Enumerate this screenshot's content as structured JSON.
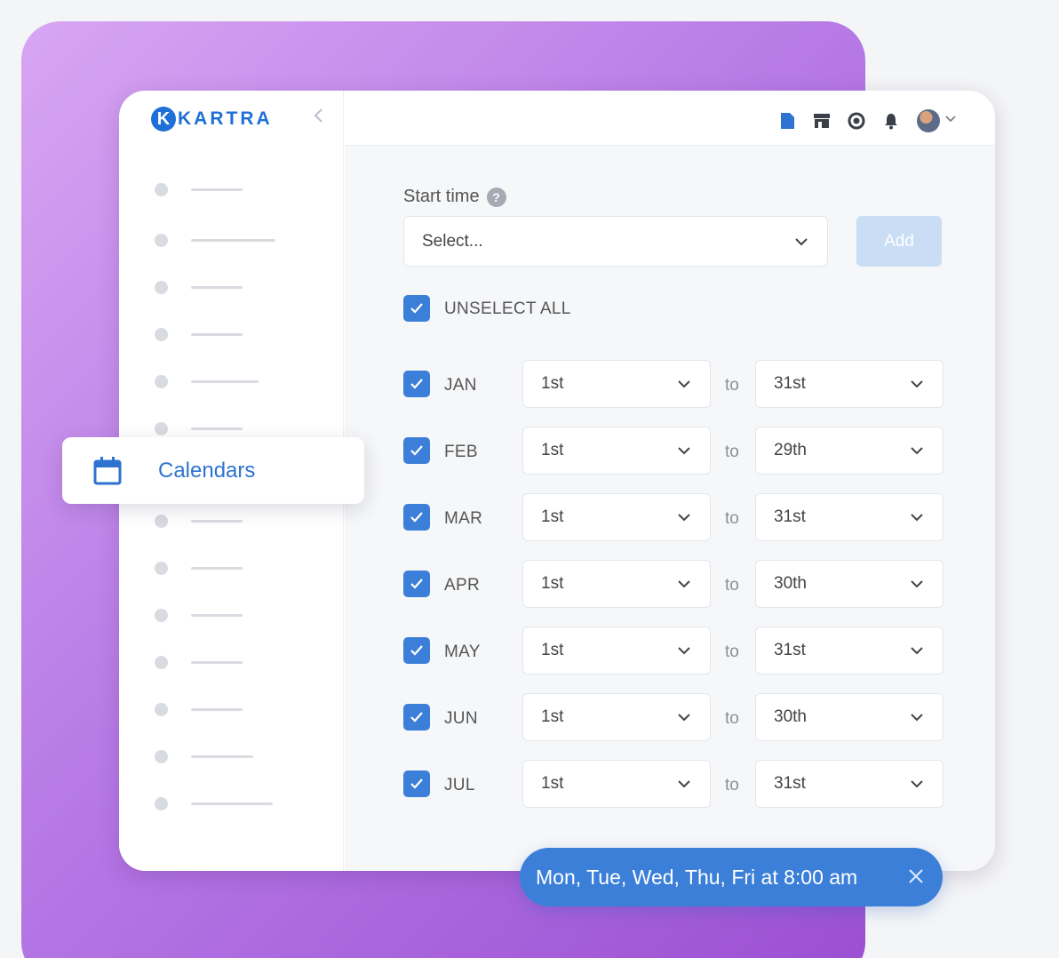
{
  "brand": {
    "name": "KARTRA",
    "logo_letter": "K",
    "accent": "#1f6fd8",
    "purple": "#b77ae6"
  },
  "topbar": {
    "icons": [
      "document-icon",
      "store-icon",
      "help-ring-icon",
      "bell-icon"
    ]
  },
  "sidebar": {
    "active_item": "Calendars"
  },
  "form": {
    "start_time_label": "Start time",
    "help_glyph": "?",
    "select_placeholder": "Select...",
    "add_label": "Add",
    "unselect_all_label": "UNSELECT ALL",
    "to_label": "to",
    "months": [
      {
        "month": "JAN",
        "from": "1st",
        "to": "31st",
        "checked": true
      },
      {
        "month": "FEB",
        "from": "1st",
        "to": "29th",
        "checked": true
      },
      {
        "month": "MAR",
        "from": "1st",
        "to": "31st",
        "checked": true
      },
      {
        "month": "APR",
        "from": "1st",
        "to": "30th",
        "checked": true
      },
      {
        "month": "MAY",
        "from": "1st",
        "to": "31st",
        "checked": true
      },
      {
        "month": "JUN",
        "from": "1st",
        "to": "30th",
        "checked": true
      },
      {
        "month": "JUL",
        "from": "1st",
        "to": "31st",
        "checked": true
      }
    ]
  },
  "schedule_pill": {
    "text": "Mon, Tue, Wed, Thu, Fri at 8:00 am"
  }
}
